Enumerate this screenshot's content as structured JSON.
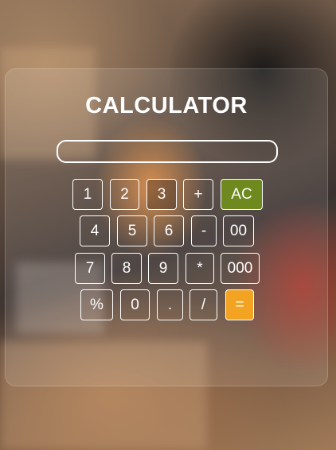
{
  "title": "CALCULATOR",
  "display": {
    "value": ""
  },
  "keys": {
    "k1": "1",
    "k2": "2",
    "k3": "3",
    "plus": "+",
    "ac": "AC",
    "k4": "4",
    "k5": "5",
    "k6": "6",
    "minus": "-",
    "k00": "00",
    "k7": "7",
    "k8": "8",
    "k9": "9",
    "multiply": "*",
    "k000": "000",
    "percent": "%",
    "k0": "0",
    "dot": ".",
    "divide": "/",
    "equals": "="
  },
  "colors": {
    "accent_orange": "#f2a322",
    "ac_green": "#6e8a1e",
    "key_border": "#ffffff"
  }
}
